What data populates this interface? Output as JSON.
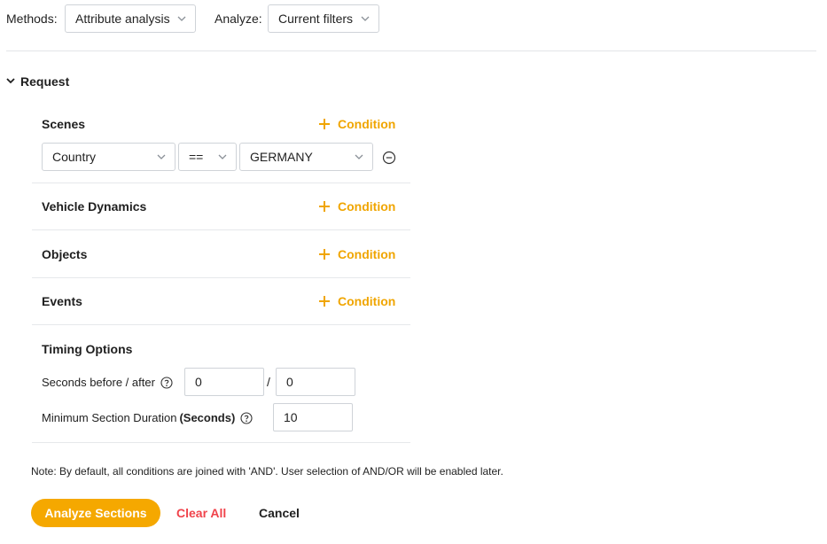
{
  "toolbar": {
    "methods_label": "Methods:",
    "methods_value": "Attribute analysis",
    "analyze_label": "Analyze:",
    "analyze_value": "Current filters"
  },
  "request": {
    "title": "Request",
    "add_condition_label": "Condition",
    "sections": [
      {
        "title": "Scenes"
      },
      {
        "title": "Vehicle Dynamics"
      },
      {
        "title": "Objects"
      },
      {
        "title": "Events"
      }
    ],
    "scene_condition": {
      "attribute": "Country",
      "operator": "==",
      "value": "GERMANY"
    },
    "timing": {
      "title": "Timing Options",
      "seconds_label": "Seconds before / after",
      "seconds_before": "0",
      "seconds_after": "0",
      "slash": "/",
      "min_duration_label": "Minimum Section Duration",
      "min_duration_unit": "(Seconds)",
      "min_duration_value": "10"
    }
  },
  "note": "Note: By default, all conditions are joined with 'AND'. User selection of AND/OR will be enabled later.",
  "actions": {
    "analyze": "Analyze Sections",
    "clear": "Clear All",
    "cancel": "Cancel"
  },
  "colors": {
    "accent": "#f5a800",
    "danger": "#f0434b",
    "border": "#cfd3d8"
  },
  "icons": {
    "chevron": "chevron-down-icon",
    "plus": "plus-icon",
    "remove": "minus-circle-icon",
    "help": "help-circle-icon"
  }
}
